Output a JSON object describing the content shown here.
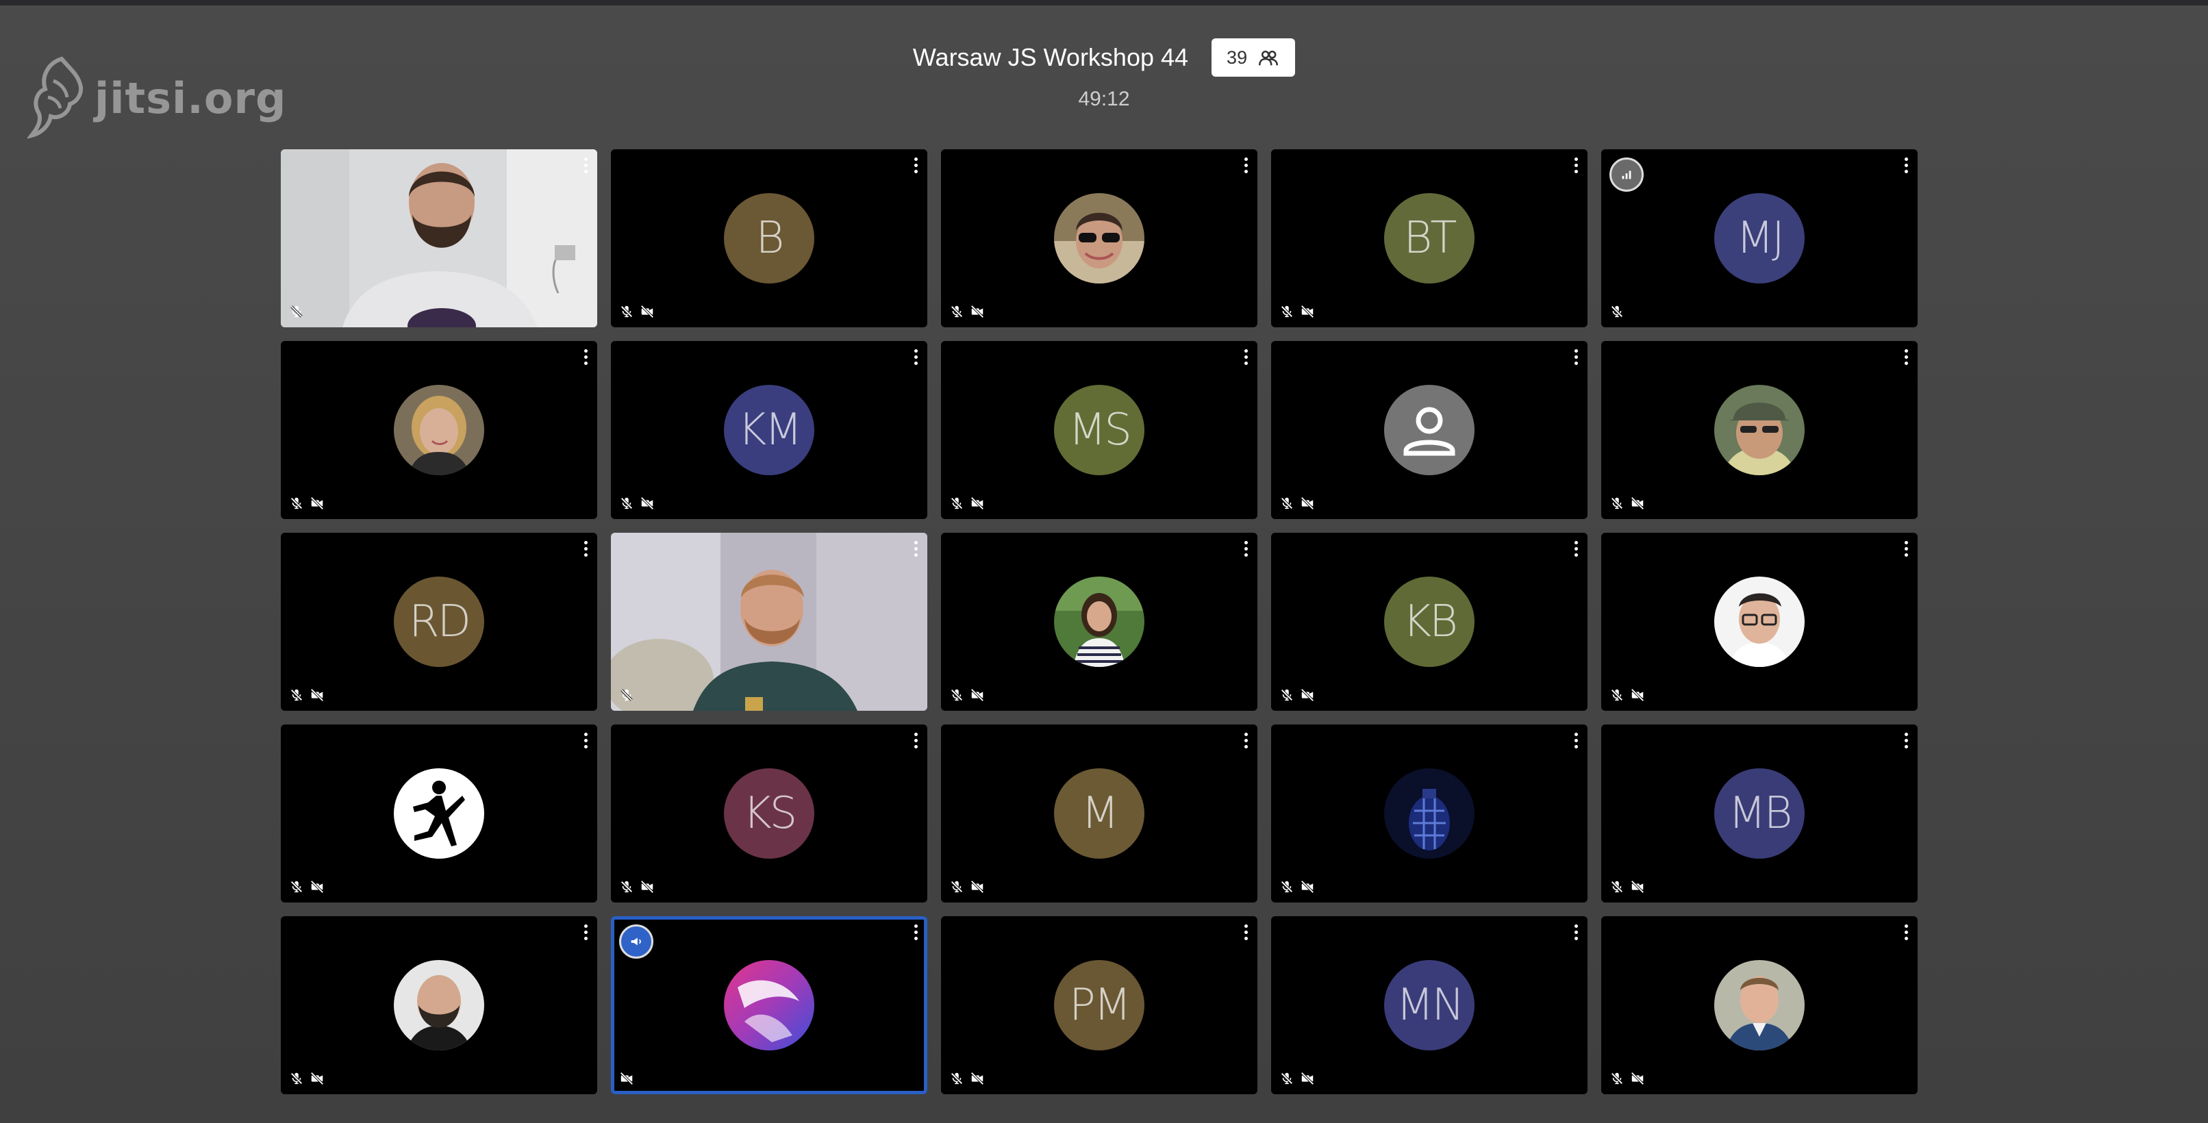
{
  "watermark": {
    "text": "jitsi.org"
  },
  "meeting": {
    "title": "Warsaw JS Workshop 44",
    "participant_count": "39",
    "timer": "49:12"
  },
  "tiles": [
    {
      "kind": "video",
      "scene": "room-beard"
    },
    {
      "kind": "initials",
      "initials": "B",
      "color": "#6b5834"
    },
    {
      "kind": "photo",
      "photo": "sunglasses"
    },
    {
      "kind": "initials",
      "initials": "BT",
      "color": "#626a3a"
    },
    {
      "kind": "initials",
      "initials": "MJ",
      "color": "#3b3f7a",
      "badge": "signal-icon"
    },
    {
      "kind": "photo",
      "photo": "woman-blonde"
    },
    {
      "kind": "initials",
      "initials": "KM",
      "color": "#3a3e7e"
    },
    {
      "kind": "initials",
      "initials": "MS",
      "color": "#626c35"
    },
    {
      "kind": "default-avatar"
    },
    {
      "kind": "photo",
      "photo": "cap-man"
    },
    {
      "kind": "initials",
      "initials": "RD",
      "color": "#6a5732"
    },
    {
      "kind": "video",
      "scene": "room-ginger"
    },
    {
      "kind": "photo",
      "photo": "woman-striped"
    },
    {
      "kind": "initials",
      "initials": "KB",
      "color": "#5f6a36"
    },
    {
      "kind": "photo",
      "photo": "glasses-man"
    },
    {
      "kind": "photo",
      "photo": "jumpman-logo"
    },
    {
      "kind": "initials",
      "initials": "KS",
      "color": "#6a3348"
    },
    {
      "kind": "initials",
      "initials": "M",
      "color": "#6b5a34"
    },
    {
      "kind": "photo",
      "photo": "blue-grenade"
    },
    {
      "kind": "initials",
      "initials": "MB",
      "color": "#3a3c78"
    },
    {
      "kind": "photo",
      "photo": "bald-beard"
    },
    {
      "kind": "photo",
      "photo": "pink-abstract",
      "active": true,
      "badge": "speaker-icon"
    },
    {
      "kind": "initials",
      "initials": "PM",
      "color": "#6a5734"
    },
    {
      "kind": "initials",
      "initials": "MN",
      "color": "#3a3c7a"
    },
    {
      "kind": "photo",
      "photo": "suit-man"
    }
  ],
  "colors": {
    "active_border": "#2a5fc4",
    "dominant_speaker_badge": "#2f63c8",
    "signal_badge": "#6a6a6a"
  }
}
